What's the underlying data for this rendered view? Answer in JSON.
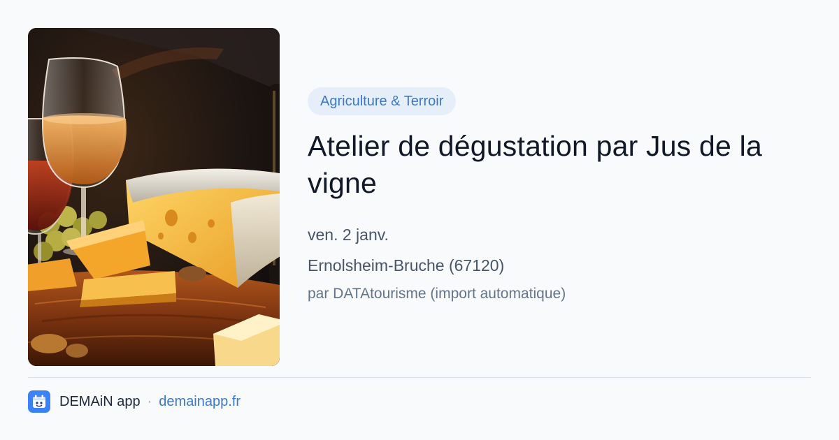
{
  "event": {
    "image_alt": "Wine glasses with cheese on a wooden board",
    "category": "Agriculture & Terroir",
    "title": "Atelier de dégustation par Jus de la vigne",
    "date": "ven. 2 janv.",
    "location": "Ernolsheim-Bruche (67120)",
    "source": "par DATAtourisme (import automatique)"
  },
  "footer": {
    "app_name": "DEMAiN app",
    "separator": "·",
    "url_label": "demainapp.fr",
    "icon": "app-logo-icon"
  },
  "colors": {
    "badge_background": "#e6eef9",
    "badge_text": "#3b78c9",
    "link": "#3b78c9",
    "app_icon": "#3b82f6",
    "page_background": "#f8fafc"
  }
}
